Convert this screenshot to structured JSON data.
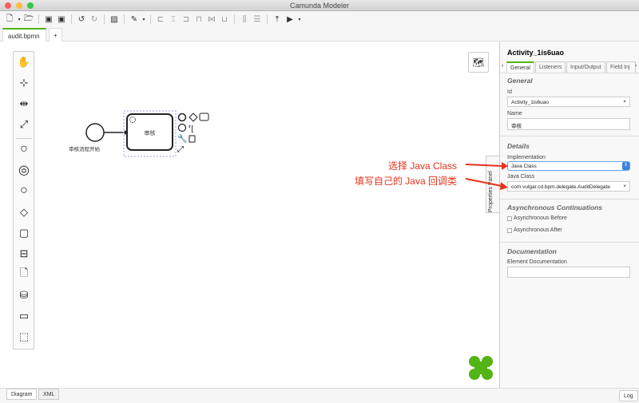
{
  "window": {
    "title": "Camunda Modeler"
  },
  "file_tabs": [
    {
      "label": "audit.bpmn",
      "unsaved": true
    },
    {
      "label": "+"
    }
  ],
  "diagram": {
    "start_event_label": "审核流程开始",
    "task_label": "审核"
  },
  "properties": {
    "element_id_title": "Activity_1is6uao",
    "tabs": [
      "General",
      "Listeners",
      "Input/Output",
      "Field Inj"
    ],
    "general_section": "General",
    "id_label": "Id",
    "id_value": "Activity_1is6uao",
    "name_label": "Name",
    "name_value": "审核",
    "details_section": "Details",
    "implementation_label": "Implementation",
    "implementation_value": "Java Class",
    "java_class_label": "Java Class",
    "java_class_value": "com.vulgar.cd.bpm.delegate.AuditDelegate",
    "async_section": "Asynchronous Continuations",
    "async_before": "Asynchronous Before",
    "async_after": "Asynchronous After",
    "doc_section": "Documentation",
    "doc_label": "Element Documentation",
    "panel_toggle": "Properties Panel"
  },
  "annotations": {
    "line1": "选择 Java Class",
    "line2": "填写自己的 Java 回调类"
  },
  "bottom": {
    "diagram_tab": "Diagram",
    "xml_tab": "XML",
    "log_button": "Log"
  },
  "colors": {
    "accent": "#52b415",
    "annotation": "#e8321d"
  }
}
